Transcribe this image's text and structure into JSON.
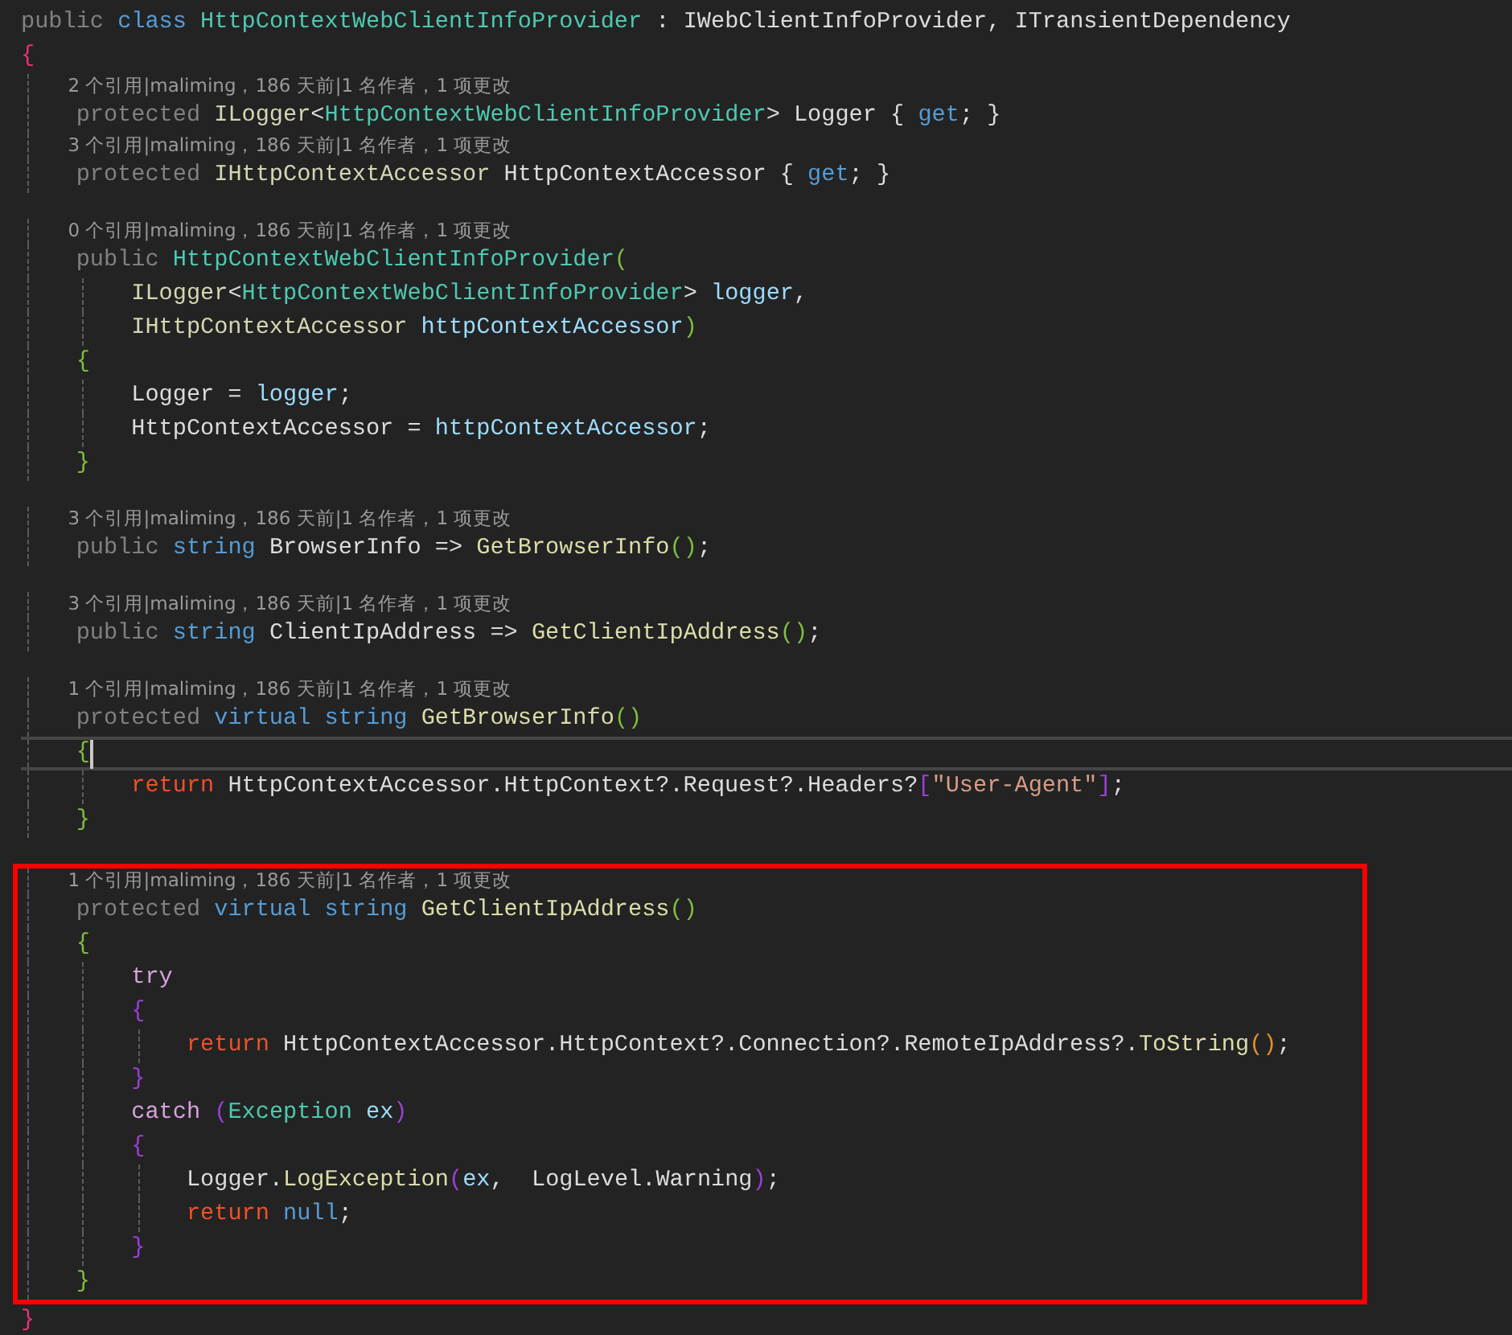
{
  "sections": [
    {
      "boxed": false,
      "lines": [
        {
          "kind": "code",
          "current": false,
          "tokens": [
            {
              "kind": "access",
              "text": "public "
            },
            {
              "kind": "keyword",
              "text": "class "
            },
            {
              "kind": "type",
              "text": "HttpContextWebClientInfoProvider"
            },
            {
              "kind": "plain",
              "text": " : "
            },
            {
              "kind": "plain",
              "text": "IWebClientInfoProvider, ITransientDependency"
            }
          ]
        },
        {
          "kind": "code",
          "current": false,
          "tokens": [
            {
              "kind": "bracket1",
              "text": "{"
            }
          ]
        },
        {
          "kind": "lens",
          "current": false,
          "tokens": [
            {
              "kind": "lens",
              "text": "    2 个引用|maliming，186 天前|1 名作者，1 项更改"
            }
          ]
        },
        {
          "kind": "code",
          "current": false,
          "tokens": [
            {
              "kind": "access",
              "text": "    protected "
            },
            {
              "kind": "iface",
              "text": "ILogger"
            },
            {
              "kind": "plain",
              "text": "<"
            },
            {
              "kind": "type",
              "text": "HttpContextWebClientInfoProvider"
            },
            {
              "kind": "plain",
              "text": "> Logger { "
            },
            {
              "kind": "keyword",
              "text": "get"
            },
            {
              "kind": "plain",
              "text": "; }"
            }
          ]
        },
        {
          "kind": "lens",
          "current": false,
          "tokens": [
            {
              "kind": "lens",
              "text": "    3 个引用|maliming，186 天前|1 名作者，1 项更改"
            }
          ]
        },
        {
          "kind": "code",
          "current": false,
          "tokens": [
            {
              "kind": "access",
              "text": "    protected "
            },
            {
              "kind": "iface",
              "text": "IHttpContextAccessor "
            },
            {
              "kind": "plain",
              "text": "HttpContextAccessor { "
            },
            {
              "kind": "keyword",
              "text": "get"
            },
            {
              "kind": "plain",
              "text": "; }"
            }
          ]
        },
        {
          "kind": "blank",
          "current": false
        },
        {
          "kind": "lens",
          "current": false,
          "tokens": [
            {
              "kind": "lens",
              "text": "    0 个引用|maliming，186 天前|1 名作者，1 项更改"
            }
          ]
        },
        {
          "kind": "code",
          "current": false,
          "tokens": [
            {
              "kind": "access",
              "text": "    public "
            },
            {
              "kind": "type",
              "text": "HttpContextWebClientInfoProvider"
            },
            {
              "kind": "bracket2",
              "text": "("
            }
          ]
        },
        {
          "kind": "code",
          "current": false,
          "tokens": [
            {
              "kind": "iface",
              "text": "        ILogger"
            },
            {
              "kind": "plain",
              "text": "<"
            },
            {
              "kind": "type",
              "text": "HttpContextWebClientInfoProvider"
            },
            {
              "kind": "plain",
              "text": "> "
            },
            {
              "kind": "param",
              "text": "logger"
            },
            {
              "kind": "plain",
              "text": ","
            }
          ]
        },
        {
          "kind": "code",
          "current": false,
          "tokens": [
            {
              "kind": "iface",
              "text": "        IHttpContextAccessor "
            },
            {
              "kind": "param",
              "text": "httpContextAccessor"
            },
            {
              "kind": "bracket2",
              "text": ")"
            }
          ]
        },
        {
          "kind": "code",
          "current": false,
          "tokens": [
            {
              "kind": "bracket2",
              "text": "    {"
            }
          ]
        },
        {
          "kind": "code",
          "current": false,
          "tokens": [
            {
              "kind": "plain",
              "text": "        Logger = "
            },
            {
              "kind": "param",
              "text": "logger"
            },
            {
              "kind": "plain",
              "text": ";"
            }
          ]
        },
        {
          "kind": "code",
          "current": false,
          "tokens": [
            {
              "kind": "plain",
              "text": "        HttpContextAccessor = "
            },
            {
              "kind": "param",
              "text": "httpContextAccessor"
            },
            {
              "kind": "plain",
              "text": ";"
            }
          ]
        },
        {
          "kind": "code",
          "current": false,
          "tokens": [
            {
              "kind": "bracket2",
              "text": "    }"
            }
          ]
        },
        {
          "kind": "blank",
          "current": false
        },
        {
          "kind": "lens",
          "current": false,
          "tokens": [
            {
              "kind": "lens",
              "text": "    3 个引用|maliming，186 天前|1 名作者，1 项更改"
            }
          ]
        },
        {
          "kind": "code",
          "current": false,
          "tokens": [
            {
              "kind": "access",
              "text": "    public "
            },
            {
              "kind": "keyword",
              "text": "string "
            },
            {
              "kind": "plain",
              "text": "BrowserInfo => "
            },
            {
              "kind": "method",
              "text": "GetBrowserInfo"
            },
            {
              "kind": "bracket2",
              "text": "()"
            },
            {
              "kind": "plain",
              "text": ";"
            }
          ]
        },
        {
          "kind": "blank",
          "current": false
        },
        {
          "kind": "lens",
          "current": false,
          "tokens": [
            {
              "kind": "lens",
              "text": "    3 个引用|maliming，186 天前|1 名作者，1 项更改"
            }
          ]
        },
        {
          "kind": "code",
          "current": false,
          "tokens": [
            {
              "kind": "access",
              "text": "    public "
            },
            {
              "kind": "keyword",
              "text": "string "
            },
            {
              "kind": "plain",
              "text": "ClientIpAddress => "
            },
            {
              "kind": "method",
              "text": "GetClientIpAddress"
            },
            {
              "kind": "bracket2",
              "text": "()"
            },
            {
              "kind": "plain",
              "text": ";"
            }
          ]
        },
        {
          "kind": "blank",
          "current": false
        },
        {
          "kind": "lens",
          "current": false,
          "tokens": [
            {
              "kind": "lens",
              "text": "    1 个引用|maliming，186 天前|1 名作者，1 项更改"
            }
          ]
        },
        {
          "kind": "code",
          "current": false,
          "tokens": [
            {
              "kind": "access",
              "text": "    protected "
            },
            {
              "kind": "keyword",
              "text": "virtual string "
            },
            {
              "kind": "method",
              "text": "GetBrowserInfo"
            },
            {
              "kind": "bracket2",
              "text": "()"
            }
          ]
        },
        {
          "kind": "code",
          "current": true,
          "tokens": [
            {
              "kind": "bracket2",
              "text": "    {"
            }
          ]
        },
        {
          "kind": "code",
          "current": false,
          "tokens": [
            {
              "kind": "control",
              "text": "        return "
            },
            {
              "kind": "plain",
              "text": "HttpContextAccessor.HttpContext?.Request?.Headers?"
            },
            {
              "kind": "bracket3",
              "text": "["
            },
            {
              "kind": "string",
              "text": "\"User-Agent\""
            },
            {
              "kind": "bracket3",
              "text": "]"
            },
            {
              "kind": "plain",
              "text": ";"
            }
          ]
        },
        {
          "kind": "code",
          "current": false,
          "tokens": [
            {
              "kind": "bracket2",
              "text": "    }"
            }
          ]
        },
        {
          "kind": "blank",
          "current": false
        }
      ]
    },
    {
      "boxed": true,
      "lines": [
        {
          "kind": "lens",
          "current": false,
          "tokens": [
            {
              "kind": "lens",
              "text": "    1 个引用|maliming，186 天前|1 名作者，1 项更改"
            }
          ]
        },
        {
          "kind": "code",
          "current": false,
          "tokens": [
            {
              "kind": "access",
              "text": "    protected "
            },
            {
              "kind": "keyword",
              "text": "virtual string "
            },
            {
              "kind": "method",
              "text": "GetClientIpAddress"
            },
            {
              "kind": "bracket2",
              "text": "()"
            }
          ]
        },
        {
          "kind": "code",
          "current": false,
          "tokens": [
            {
              "kind": "bracket2",
              "text": "    {"
            }
          ]
        },
        {
          "kind": "code",
          "current": false,
          "tokens": [
            {
              "kind": "flow",
              "text": "        try"
            }
          ]
        },
        {
          "kind": "code",
          "current": false,
          "tokens": [
            {
              "kind": "bracket3",
              "text": "        {"
            }
          ]
        },
        {
          "kind": "code",
          "current": false,
          "tokens": [
            {
              "kind": "control",
              "text": "            return "
            },
            {
              "kind": "plain",
              "text": "HttpContextAccessor.HttpContext?.Connection?.RemoteIpAddress?."
            },
            {
              "kind": "method",
              "text": "ToString"
            },
            {
              "kind": "bracket4",
              "text": "()"
            },
            {
              "kind": "plain",
              "text": ";"
            }
          ]
        },
        {
          "kind": "code",
          "current": false,
          "tokens": [
            {
              "kind": "bracket3",
              "text": "        }"
            }
          ]
        },
        {
          "kind": "code",
          "current": false,
          "tokens": [
            {
              "kind": "flow",
              "text": "        catch "
            },
            {
              "kind": "bracket3",
              "text": "("
            },
            {
              "kind": "type",
              "text": "Exception "
            },
            {
              "kind": "param",
              "text": "ex"
            },
            {
              "kind": "bracket3",
              "text": ")"
            }
          ]
        },
        {
          "kind": "code",
          "current": false,
          "tokens": [
            {
              "kind": "bracket3",
              "text": "        {"
            }
          ]
        },
        {
          "kind": "code",
          "current": false,
          "tokens": [
            {
              "kind": "plain",
              "text": "            Logger."
            },
            {
              "kind": "method",
              "text": "LogException"
            },
            {
              "kind": "bracket3",
              "text": "("
            },
            {
              "kind": "param",
              "text": "ex"
            },
            {
              "kind": "plain",
              "text": ",  LogLevel.Warning"
            },
            {
              "kind": "bracket3",
              "text": ")"
            },
            {
              "kind": "plain",
              "text": ";"
            }
          ]
        },
        {
          "kind": "code",
          "current": false,
          "tokens": [
            {
              "kind": "control",
              "text": "            return "
            },
            {
              "kind": "keyword",
              "text": "null"
            },
            {
              "kind": "plain",
              "text": ";"
            }
          ]
        },
        {
          "kind": "code",
          "current": false,
          "tokens": [
            {
              "kind": "bracket3",
              "text": "        }"
            }
          ]
        },
        {
          "kind": "code",
          "current": false,
          "tokens": [
            {
              "kind": "bracket2",
              "text": "    }"
            }
          ]
        }
      ]
    },
    {
      "boxed": false,
      "lines": [
        {
          "kind": "code",
          "current": false,
          "tokens": [
            {
              "kind": "bracket1",
              "text": "}"
            }
          ]
        }
      ]
    }
  ]
}
